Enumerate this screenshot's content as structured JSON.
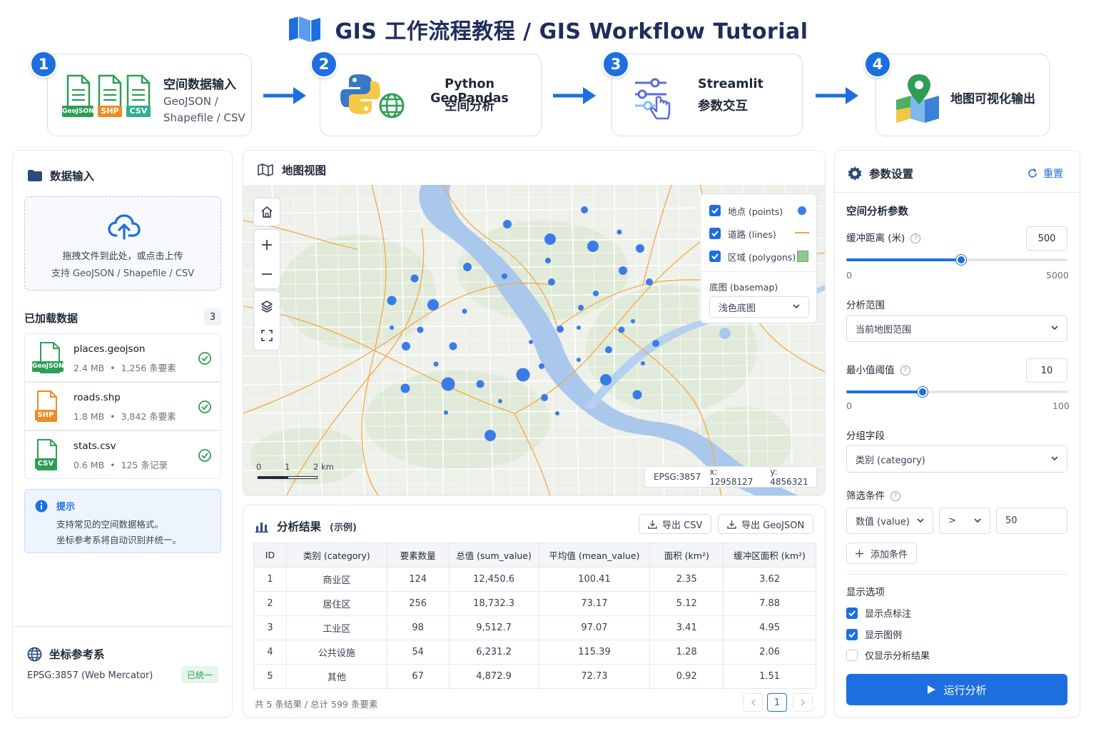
{
  "header": {
    "title": "GIS 工作流程教程 / GIS Workflow Tutorial"
  },
  "steps": [
    {
      "num": "1",
      "title": "空间数据输入",
      "sub1": "GeoJSON /",
      "sub2": "Shapefile / CSV",
      "badges": [
        "GeoJSON",
        "SHP",
        "CSV"
      ]
    },
    {
      "num": "2",
      "title": "Python GeoPandas",
      "sub1": "空间分析"
    },
    {
      "num": "3",
      "title": "Streamlit",
      "sub1": "参数交互"
    },
    {
      "num": "4",
      "title": "地图可视化输出"
    }
  ],
  "left_panel": {
    "title": "数据输入",
    "drop_text": "拖拽文件到此处，或点击上传",
    "drop_sub": "支持 GeoJSON / Shapefile / CSV",
    "loaded_title": "已加载数据",
    "loaded_count": "3",
    "files": [
      {
        "name": "places.geojson",
        "size": "2.4 MB",
        "count": "1,256 条要素",
        "badge": "GeoJSON",
        "color": "#2e9e55"
      },
      {
        "name": "roads.shp",
        "size": "1.8 MB",
        "count": "3,842 条要素",
        "badge": "SHP",
        "color": "#f08a24"
      },
      {
        "name": "stats.csv",
        "size": "0.6 MB",
        "count": "125 条记录",
        "badge": "CSV",
        "color": "#2e9e55"
      }
    ],
    "tip_title": "提示",
    "tip_line1": "支持常见的空间数据格式。",
    "tip_line2": "坐标参考系将自动识别并统一。",
    "crs_title": "坐标参考系",
    "crs_value": "EPSG:3857 (Web Mercator)",
    "crs_badge": "已统一"
  },
  "map_panel": {
    "title": "地图视图",
    "legend": {
      "points": "地点 (points)",
      "lines": "道路 (lines)",
      "polygons": "区域 (polygons)",
      "basemap_label": "底图 (basemap)",
      "basemap_value": "浅色底图"
    },
    "scale": {
      "l0": "0",
      "l1": "1",
      "l2": "2 km"
    },
    "coords": {
      "epsg": "EPSG:3857",
      "x": "x: 12958127",
      "y": "y: 4856321"
    },
    "colors": {
      "points": "#3b7be8",
      "lines": "#f0a43a",
      "polygons": "#8fc88c",
      "river": "#a9c8ec"
    }
  },
  "results": {
    "title": "分析结果",
    "title_note": "(示例)",
    "export_csv": "导出 CSV",
    "export_geojson": "导出 GeoJSON",
    "columns": [
      "ID",
      "类别 (category)",
      "要素数量",
      "总值 (sum_value)",
      "平均值 (mean_value)",
      "面积 (km²)",
      "缓冲区面积 (km²)"
    ],
    "rows": [
      [
        "1",
        "商业区",
        "124",
        "12,450.6",
        "100.41",
        "2.35",
        "3.62"
      ],
      [
        "2",
        "居住区",
        "256",
        "18,732.3",
        "73.17",
        "5.12",
        "7.88"
      ],
      [
        "3",
        "工业区",
        "98",
        "9,512.7",
        "97.07",
        "3.41",
        "4.95"
      ],
      [
        "4",
        "公共设施",
        "54",
        "6,231.2",
        "115.39",
        "1.28",
        "2.06"
      ],
      [
        "5",
        "其他",
        "67",
        "4,872.9",
        "72.73",
        "0.92",
        "1.51"
      ]
    ],
    "footer": "共 5 条结果 / 总计 599 条要素",
    "page": "1"
  },
  "params": {
    "title": "参数设置",
    "reset": "重置",
    "section": "空间分析参数",
    "buffer_label": "缓冲距离 (米)",
    "buffer_value": "500",
    "buffer_min": "0",
    "buffer_max": "5000",
    "buffer_fraction": 0.52,
    "scope_label": "分析范围",
    "scope_value": "当前地图范围",
    "threshold_label": "最小值阈值",
    "threshold_value": "10",
    "threshold_min": "0",
    "threshold_max": "100",
    "threshold_fraction": 0.345,
    "group_label": "分组字段",
    "group_value": "类别 (category)",
    "filter_label": "筛选条件",
    "filter_field": "数值 (value)",
    "filter_op": ">",
    "filter_value": "50",
    "add_condition": "添加条件",
    "display_label": "显示选项",
    "opt_point_labels": "显示点标注",
    "opt_legend": "显示图例",
    "opt_only_results": "仅显示分析结果",
    "run": "运行分析"
  }
}
